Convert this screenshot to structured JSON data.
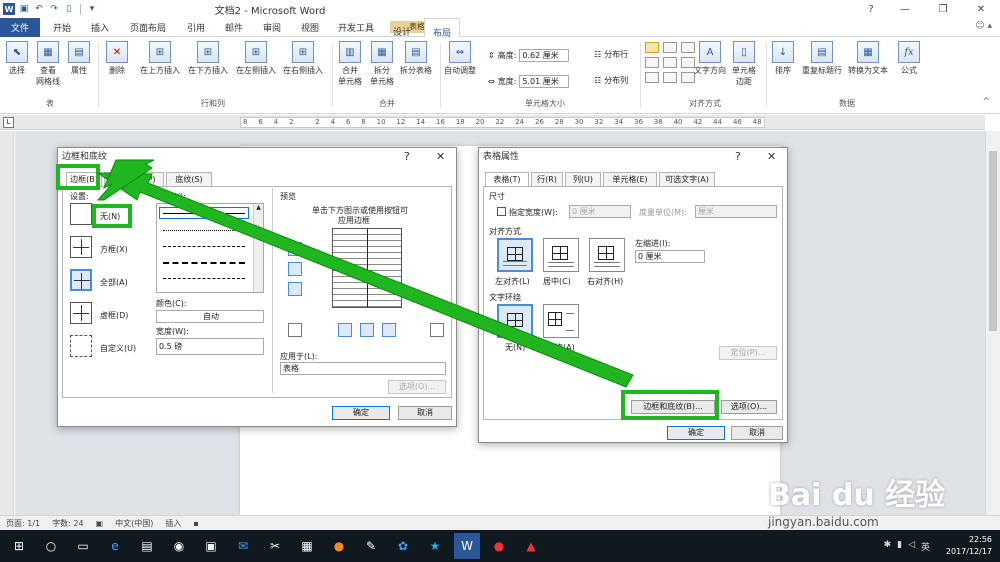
{
  "window": {
    "title": "文档2 - Microsoft Word",
    "controls": [
      "?",
      "—",
      "❐",
      "✕"
    ],
    "help": "?"
  },
  "ribbon_tabs": {
    "file": "文件",
    "items": [
      "开始",
      "插入",
      "页面布局",
      "引用",
      "邮件",
      "审阅",
      "视图",
      "开发工具",
      "设计",
      "布局"
    ],
    "context_group": "表格工具",
    "active": "布局"
  },
  "ribbon": {
    "buttons": {
      "select": "选择",
      "view_grid": "查看\n网格线",
      "properties": "属性",
      "delete": "删除",
      "insert_above": "在上方插入",
      "insert_below": "在下方插入",
      "insert_left": "在左侧插入",
      "insert_right": "在右侧插入",
      "merge_cells": "合并\n单元格",
      "split_cells": "拆分\n单元格",
      "split_table": "拆分表格",
      "autofit": "自动调整",
      "text_direction": "文字方向",
      "cell_margins": "单元格\n边距",
      "sort": "排序",
      "repeat_header": "重复标题行",
      "convert_text": "转换为文本",
      "formula": "公式"
    },
    "height_label": "高度:",
    "height_value": "0.62 厘米",
    "width_label": "宽度:",
    "width_value": "5.01 厘米",
    "distribute_rows": "分布行",
    "distribute_cols": "分布列",
    "groups": {
      "table": "表",
      "rows_cols": "行和列",
      "merge": "合并",
      "cell_size": "单元格大小",
      "alignment": "对齐方式",
      "data": "数据"
    }
  },
  "ruler": {
    "corner": "L",
    "ticks": [
      "8",
      "6",
      "4",
      "2",
      "",
      "2",
      "4",
      "6",
      "8",
      "10",
      "12",
      "14",
      "16",
      "18",
      "20",
      "22",
      "24",
      "26",
      "28",
      "30",
      "32",
      "34",
      "36",
      "38",
      "40",
      "42",
      "44",
      "46",
      "48"
    ]
  },
  "borders_dialog": {
    "title": "边框和底纹",
    "help": "?",
    "close": "✕",
    "tabs": [
      "边框(B)",
      "页面边框(P)",
      "底纹(S)"
    ],
    "setting_label": "设置:",
    "settings": [
      "无(N)",
      "方框(X)",
      "全部(A)",
      "虚框(D)",
      "自定义(U)"
    ],
    "style_label": "样式(Y):",
    "color_label": "颜色(C):",
    "color_value": "自动",
    "width_label": "宽度(W):",
    "width_value": "0.5 磅",
    "preview_label": "预览",
    "preview_hint_1": "单击下方图示或使用按钮可",
    "preview_hint_2": "应用边框",
    "apply_to_label": "应用于(L):",
    "apply_to_value": "表格",
    "options": "选项(O)...",
    "ok": "确定",
    "cancel": "取消"
  },
  "table_props_dialog": {
    "title": "表格属性",
    "help": "?",
    "close": "✕",
    "tabs": [
      "表格(T)",
      "行(R)",
      "列(U)",
      "单元格(E)",
      "可选文字(A)"
    ],
    "size_label": "尺寸",
    "preferred_width_label": "指定宽度(W):",
    "preferred_width_value": "0 厘米",
    "measure_in_label": "度量单位(M):",
    "measure_in_value": "厘米",
    "alignment_label": "对齐方式",
    "align_left": "左对齐(L)",
    "align_center": "居中(C)",
    "align_right": "右对齐(H)",
    "indent_label": "左缩进(I):",
    "indent_value": "0 厘米",
    "wrapping_label": "文字环绕",
    "wrap_none": "无(N)",
    "wrap_around": "环绕(A)",
    "positioning": "定位(P)...",
    "borders_shading": "边框和底纹(B)...",
    "options": "选项(O)...",
    "ok": "确定",
    "cancel": "取消"
  },
  "statusbar": {
    "page": "页面: 1/1",
    "words": "字数: 24",
    "language": "中文(中国)",
    "mode": "插入"
  },
  "taskbar": {
    "time": "22:56",
    "date": "2017/12/17",
    "ime": "英"
  },
  "watermark": {
    "brand": "Bai du 经验",
    "url": "jingyan.baidu.com"
  },
  "colors": {
    "word_blue": "#2b579a",
    "highlight_green": "#1fb61f",
    "context_tab": "#e8d098"
  }
}
